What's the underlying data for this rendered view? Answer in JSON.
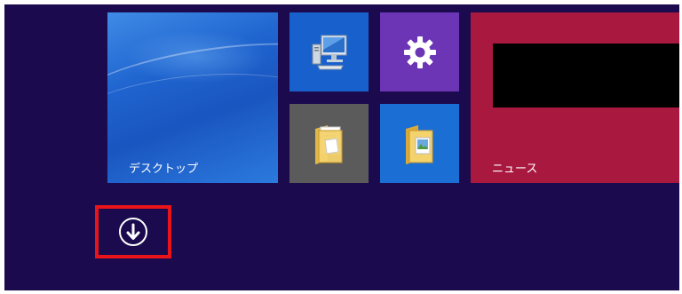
{
  "start_screen": {
    "background_color": "#1b0b4e",
    "tiles": [
      {
        "id": "desktop",
        "label": "デスクトップ",
        "color": "#1f64cf",
        "icon": "desktop-wallpaper"
      },
      {
        "id": "pc",
        "label": "",
        "color": "#1861cc",
        "icon": "computer-monitor-icon"
      },
      {
        "id": "settings",
        "label": "",
        "color": "#6b35b6",
        "icon": "gear-icon"
      },
      {
        "id": "explorer",
        "label": "",
        "color": "#5b5b5b",
        "icon": "folder-document-icon"
      },
      {
        "id": "photos",
        "label": "",
        "color": "#1b6fd4",
        "icon": "folder-picture-icon"
      },
      {
        "id": "news",
        "label": "ニュース",
        "color": "#a8183f",
        "icon": ""
      }
    ],
    "all_apps_button": {
      "icon": "arrow-down-circle-icon",
      "highlight_color": "#e8141a"
    }
  }
}
